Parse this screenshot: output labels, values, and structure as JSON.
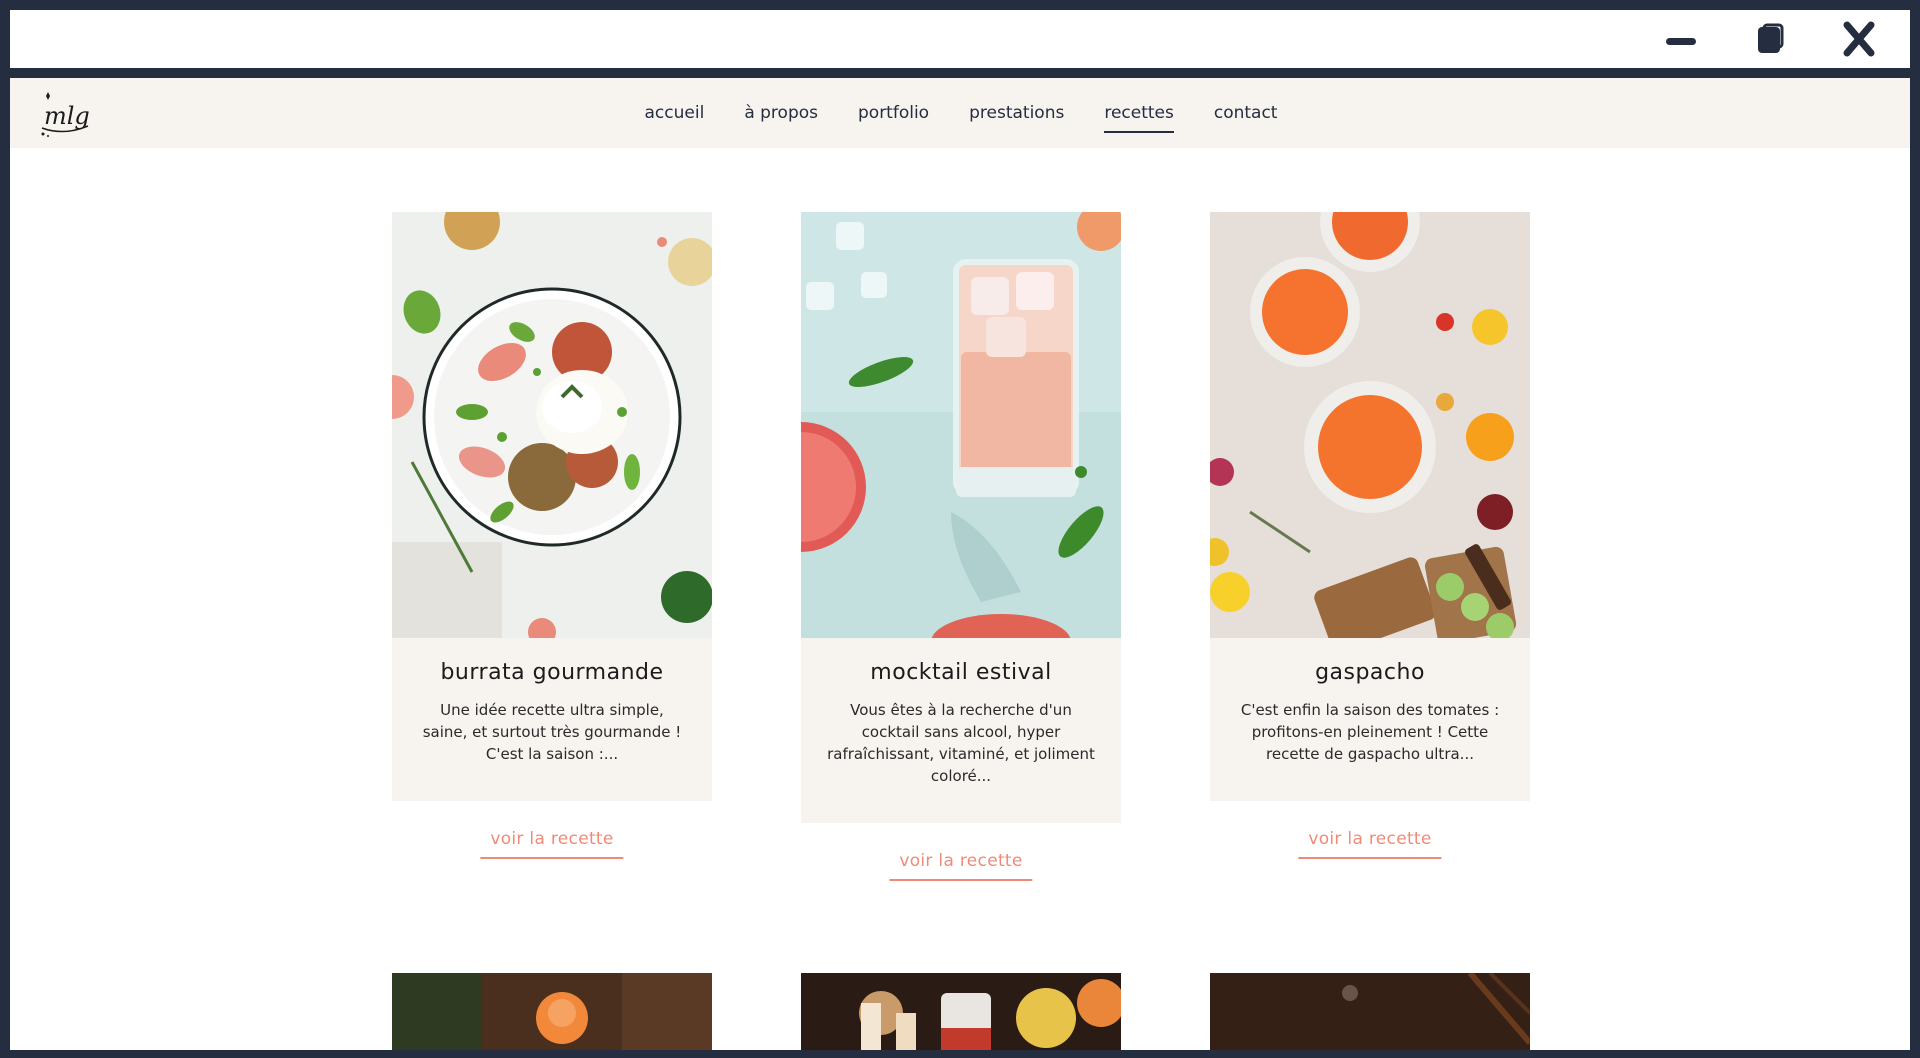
{
  "window": {
    "controls": [
      "minimize-icon",
      "maximize-icon",
      "close-icon"
    ]
  },
  "nav": {
    "logo_text": "mlg",
    "items": [
      {
        "label": "accueil"
      },
      {
        "label": "à propos"
      },
      {
        "label": "portfolio"
      },
      {
        "label": "prestations"
      },
      {
        "label": "recettes"
      },
      {
        "label": "contact"
      }
    ],
    "active": "recettes"
  },
  "recipes": [
    {
      "title": "burrata gourmande",
      "description": "Une idée recette ultra simple, saine, et surtout très gourmande ! C'est la saison :...",
      "link": "voir la recette",
      "image": "burrata salad plate photo"
    },
    {
      "title": "mocktail estival",
      "description": "Vous êtes à la recherche d'un cocktail sans alcool, hyper rafraîchissant, vitaminé, et joliment coloré...",
      "link": "voir la recette",
      "image": "pink grapefruit mocktail glass photo"
    },
    {
      "title": "gaspacho",
      "description": "C'est enfin la saison des tomates : profitons-en pleinement ! Cette recette de gaspacho ultra...",
      "link": "voir la recette",
      "image": "gazpacho bowls with vegetables photo"
    }
  ],
  "colors": {
    "frame": "#252d40",
    "nav_bg": "#f7f3ef",
    "accent": "#f08a78",
    "text": "#252d40"
  }
}
